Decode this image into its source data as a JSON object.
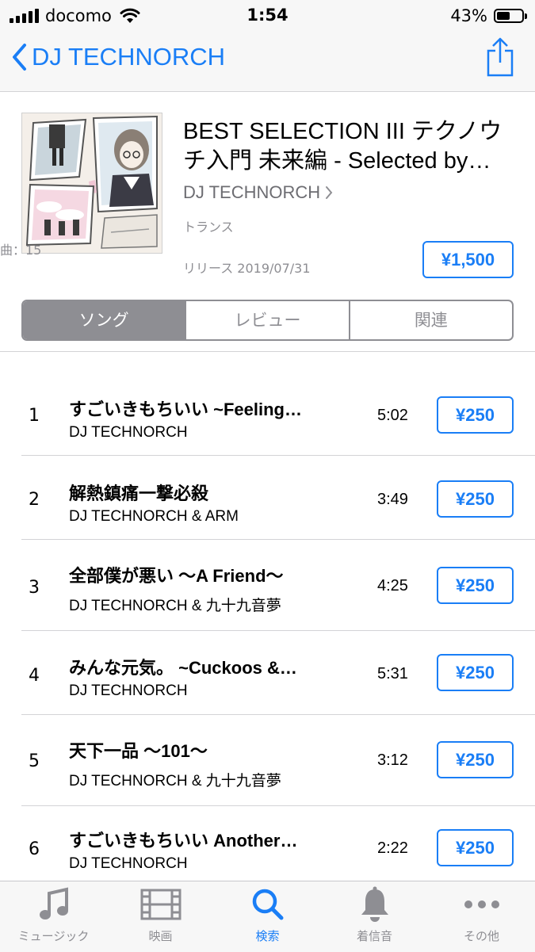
{
  "status_bar": {
    "carrier": "docomo",
    "time": "1:54",
    "battery": "43%"
  },
  "nav": {
    "back_label": "DJ TECHNORCH"
  },
  "album": {
    "title": "BEST SELECTION III テクノウチ入門 未来編 - Selected by…",
    "artist": "DJ TECHNORCH",
    "genre": "トランス",
    "track_count": "曲：15",
    "release": "リリース 2019/07/31",
    "price": "¥1,500"
  },
  "segments": [
    "ソング",
    "レビュー",
    "関連"
  ],
  "tracks": [
    {
      "number": "1",
      "title": "すごいきもちいい ~Feeling…",
      "artist": "DJ TECHNORCH",
      "duration": "5:02",
      "price": "¥250"
    },
    {
      "number": "2",
      "title": "解熱鎮痛一撃必殺",
      "artist": "DJ TECHNORCH & ARM",
      "duration": "3:49",
      "price": "¥250"
    },
    {
      "number": "3",
      "title": "全部僕が悪い 〜A Friend〜",
      "artist": "DJ TECHNORCH & 九十九音夢",
      "duration": "4:25",
      "price": "¥250"
    },
    {
      "number": "4",
      "title": "みんな元気。 ~Cuckoos &…",
      "artist": "DJ TECHNORCH",
      "duration": "5:31",
      "price": "¥250"
    },
    {
      "number": "5",
      "title": "天下一品 〜101〜",
      "artist": "DJ TECHNORCH & 九十九音夢",
      "duration": "3:12",
      "price": "¥250"
    },
    {
      "number": "6",
      "title": "すごいきもちいい Another…",
      "artist": "DJ TECHNORCH",
      "duration": "2:22",
      "price": "¥250"
    }
  ],
  "tab_bar": {
    "items": [
      {
        "label": "ミュージック",
        "icon": "music-note-icon"
      },
      {
        "label": "映画",
        "icon": "film-icon"
      },
      {
        "label": "検索",
        "icon": "search-icon"
      },
      {
        "label": "着信音",
        "icon": "bell-icon"
      },
      {
        "label": "その他",
        "icon": "more-icon"
      }
    ],
    "active": "検索"
  },
  "colors": {
    "accent": "#1a7ef6",
    "secondary_text": "#8e8e93",
    "bar_bg": "#f7f7f7"
  }
}
